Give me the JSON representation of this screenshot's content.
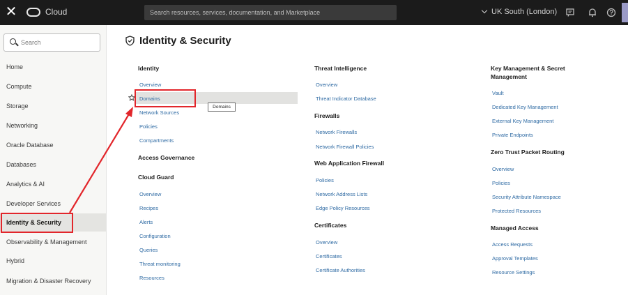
{
  "topbar": {
    "close_icon": "close-icon",
    "brand": "Cloud",
    "search_placeholder": "Search resources, services, documentation, and Marketplace",
    "region": "UK South (London)",
    "icons": [
      "announcements-icon",
      "notifications-icon",
      "help-icon"
    ]
  },
  "sidebar": {
    "search_placeholder": "Search",
    "items": [
      {
        "label": "Home"
      },
      {
        "label": "Compute"
      },
      {
        "label": "Storage"
      },
      {
        "label": "Networking"
      },
      {
        "label": "Oracle Database"
      },
      {
        "label": "Databases"
      },
      {
        "label": "Analytics & AI"
      },
      {
        "label": "Developer Services"
      },
      {
        "label": "Identity & Security",
        "active": true
      },
      {
        "label": "Observability & Management"
      },
      {
        "label": "Hybrid"
      },
      {
        "label": "Migration & Disaster Recovery"
      }
    ]
  },
  "main": {
    "title": "Identity & Security",
    "tooltip": "Domains",
    "col1": {
      "identity": {
        "title": "Identity",
        "links": [
          "Overview",
          "Domains",
          "Network Sources",
          "Policies",
          "Compartments"
        ]
      },
      "access_governance": {
        "title": "Access Governance"
      },
      "cloud_guard": {
        "title": "Cloud Guard",
        "links": [
          "Overview",
          "Recipes",
          "Alerts",
          "Configuration",
          "Queries",
          "Threat monitoring",
          "Resources"
        ]
      }
    },
    "col2": {
      "threat_intelligence": {
        "title": "Threat Intelligence",
        "links": [
          "Overview",
          "Threat Indicator Database"
        ]
      },
      "firewalls": {
        "title": "Firewalls",
        "links": [
          "Network Firewalls",
          "Network Firewall Policies"
        ]
      },
      "waf": {
        "title": "Web Application Firewall",
        "links": [
          "Policies",
          "Network Address Lists",
          "Edge Policy Resources"
        ]
      },
      "certificates": {
        "title": "Certificates",
        "links": [
          "Overview",
          "Certificates",
          "Certificate Authorities"
        ]
      }
    },
    "col3": {
      "kms": {
        "title_line1": "Key Management & Secret",
        "title_line2": "Management",
        "links": [
          "Vault",
          "Dedicated Key Management",
          "External Key Management",
          "Private Endpoints"
        ]
      },
      "zpr": {
        "title": "Zero Trust Packet Routing",
        "links": [
          "Overview",
          "Policies",
          "Security Attribute Namespace",
          "Protected Resources"
        ]
      },
      "managed_access": {
        "title": "Managed Access",
        "links": [
          "Access Requests",
          "Approval Templates",
          "Resource Settings"
        ]
      }
    }
  },
  "annotation": {
    "color": "#e2262b"
  }
}
